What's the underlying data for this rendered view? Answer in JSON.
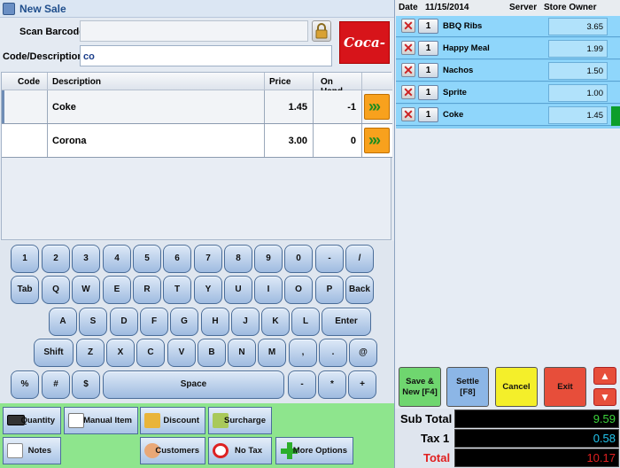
{
  "window": {
    "title": "New Sale"
  },
  "form": {
    "scan_label": "Scan Barcode",
    "scan_value": "",
    "code_label": "Code/Description",
    "code_value": "co",
    "logo_text": "Coca-Cola"
  },
  "grid": {
    "headers": [
      "Code",
      "Description",
      "Price",
      "On Hand"
    ],
    "rows": [
      {
        "code": "",
        "description": "Coke",
        "price": "1.45",
        "on_hand": "-1"
      },
      {
        "code": "",
        "description": "Corona",
        "price": "3.00",
        "on_hand": "0"
      }
    ],
    "go_glyph": "»»"
  },
  "keyboard": {
    "row1": [
      "1",
      "2",
      "3",
      "4",
      "5",
      "6",
      "7",
      "8",
      "9",
      "0",
      "-",
      "/"
    ],
    "row2": [
      "Tab",
      "Q",
      "W",
      "E",
      "R",
      "T",
      "Y",
      "U",
      "I",
      "O",
      "P",
      "Back"
    ],
    "row3": [
      "A",
      "S",
      "D",
      "F",
      "G",
      "H",
      "J",
      "K",
      "L",
      "Enter"
    ],
    "row4": [
      "Shift",
      "Z",
      "X",
      "C",
      "V",
      "B",
      "N",
      "M",
      ",",
      ".",
      "@"
    ],
    "row5": [
      "%",
      "#",
      "$",
      "Space",
      "-",
      "*",
      "+"
    ]
  },
  "functions": {
    "quantity": "Quantity",
    "manual_item": "Manual Item",
    "discount": "Discount",
    "surcharge": "Surcharge",
    "notes": "Notes",
    "customers": "Customers",
    "no_tax": "No Tax",
    "more_options": "More Options"
  },
  "order": {
    "date_label": "Date",
    "date": "11/15/2014",
    "server_label": "Server",
    "server": "Store Owner",
    "items": [
      {
        "qty": "1",
        "name": "BBQ Ribs",
        "price": "3.65"
      },
      {
        "qty": "1",
        "name": "Happy Meal",
        "price": "1.99"
      },
      {
        "qty": "1",
        "name": "Nachos",
        "price": "1.50"
      },
      {
        "qty": "1",
        "name": "Sprite",
        "price": "1.00"
      },
      {
        "qty": "1",
        "name": "Coke",
        "price": "1.45"
      }
    ],
    "remove_glyph": "✕"
  },
  "actions": {
    "save_new_line1": "Save &",
    "save_new_line2": "New [F4]",
    "settle_line1": "Settle",
    "settle_line2": "[F8]",
    "cancel": "Cancel",
    "exit": "Exit",
    "up": "▲",
    "down": "▼"
  },
  "totals": {
    "subtotal_label": "Sub Total",
    "subtotal": "9.59",
    "tax_label": "Tax 1",
    "tax": "0.58",
    "total_label": "Total",
    "total": "10.17"
  },
  "colors": {
    "subtotal": "#3cd53c",
    "tax": "#22c7f0",
    "total": "#e02020",
    "save_new": "#6fd66f",
    "settle": "#8cb6e6",
    "cancel": "#f4ef2a",
    "exit": "#e74e3a",
    "function_bar": "#8ee58d",
    "order_list": "#87cff5",
    "selected_marker": "#0c9e2a"
  }
}
